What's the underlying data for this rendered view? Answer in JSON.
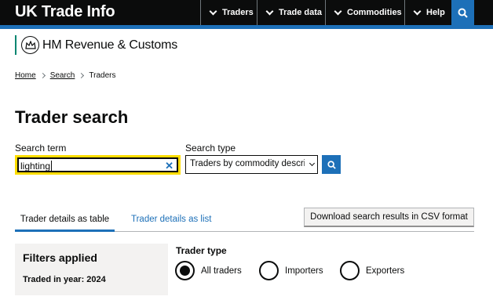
{
  "header": {
    "site_title": "UK Trade Info",
    "nav": [
      {
        "label": "Traders"
      },
      {
        "label": "Trade data"
      },
      {
        "label": "Commodities"
      },
      {
        "label": "Help"
      }
    ],
    "search_icon": "search-icon"
  },
  "department": {
    "name": "HM Revenue & Customs",
    "logo_icon": "crown-crest-icon"
  },
  "breadcrumb": {
    "home": "Home",
    "search": "Search",
    "current": "Traders"
  },
  "page": {
    "title": "Trader search"
  },
  "search": {
    "term_label": "Search term",
    "term_value": "lighting",
    "clear_icon": "✕",
    "type_label": "Search type",
    "type_selected": "Traders by commodity description",
    "submit_icon": "search-icon"
  },
  "tabs": {
    "active": "Trader details as table",
    "inactive": "Trader details as list",
    "download": "Download search results in CSV format"
  },
  "filters": {
    "title": "Filters applied",
    "traded_year": "Traded in year: 2024"
  },
  "trader_type": {
    "label": "Trader type",
    "options": [
      {
        "label": "All traders",
        "selected": true
      },
      {
        "label": "Importers",
        "selected": false
      },
      {
        "label": "Exporters",
        "selected": false
      }
    ]
  },
  "colors": {
    "header_bg": "#0b0c0c",
    "accent_blue": "#1d70b8",
    "focus_yellow": "#ffdd00",
    "hmrc_green": "#008670",
    "panel_grey": "#f3f2f1"
  }
}
